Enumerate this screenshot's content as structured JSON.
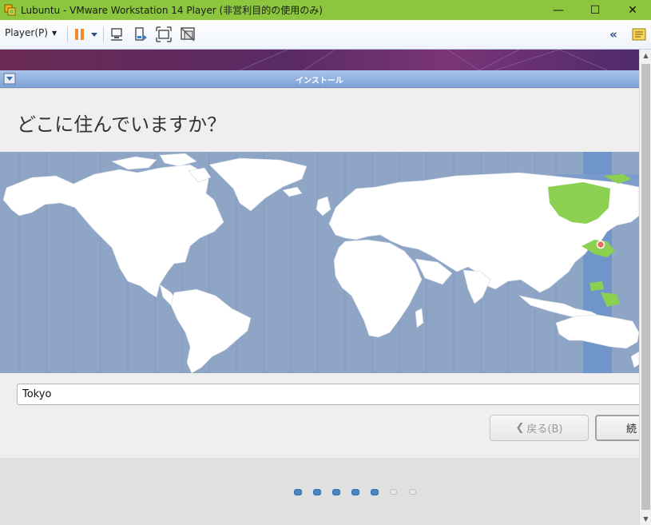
{
  "window": {
    "title": "Lubuntu - VMware Workstation 14 Player (非営利目的の使用のみ)",
    "controls": {
      "minimize": "—",
      "maximize": "☐",
      "close": "✕"
    }
  },
  "toolbar": {
    "player_menu": "Player(P)",
    "icons": [
      "pause-icon",
      "dropdown-icon",
      "send-ctrl-alt-del-icon",
      "removable-devices-icon",
      "fullscreen-icon",
      "unity-icon",
      "collapse-icon",
      "notes-icon"
    ],
    "collapse_label": "«"
  },
  "installer": {
    "window_title": "インストール",
    "question": "どこに住んでいますか？",
    "timezone_value": "Tokyo",
    "selected_region": "Asia/Tokyo",
    "back_button": "戻る(B)",
    "next_button": "続",
    "progress": {
      "total_steps": 7,
      "current_step": 5
    }
  },
  "colors": {
    "titlebar": "#8cc63e",
    "map_ocean": "#8ea5c6",
    "map_land": "#ffffff",
    "timezone_band": "#7095c9",
    "selected_zone": "#8cd052",
    "progress_active": "#4b86c4"
  }
}
